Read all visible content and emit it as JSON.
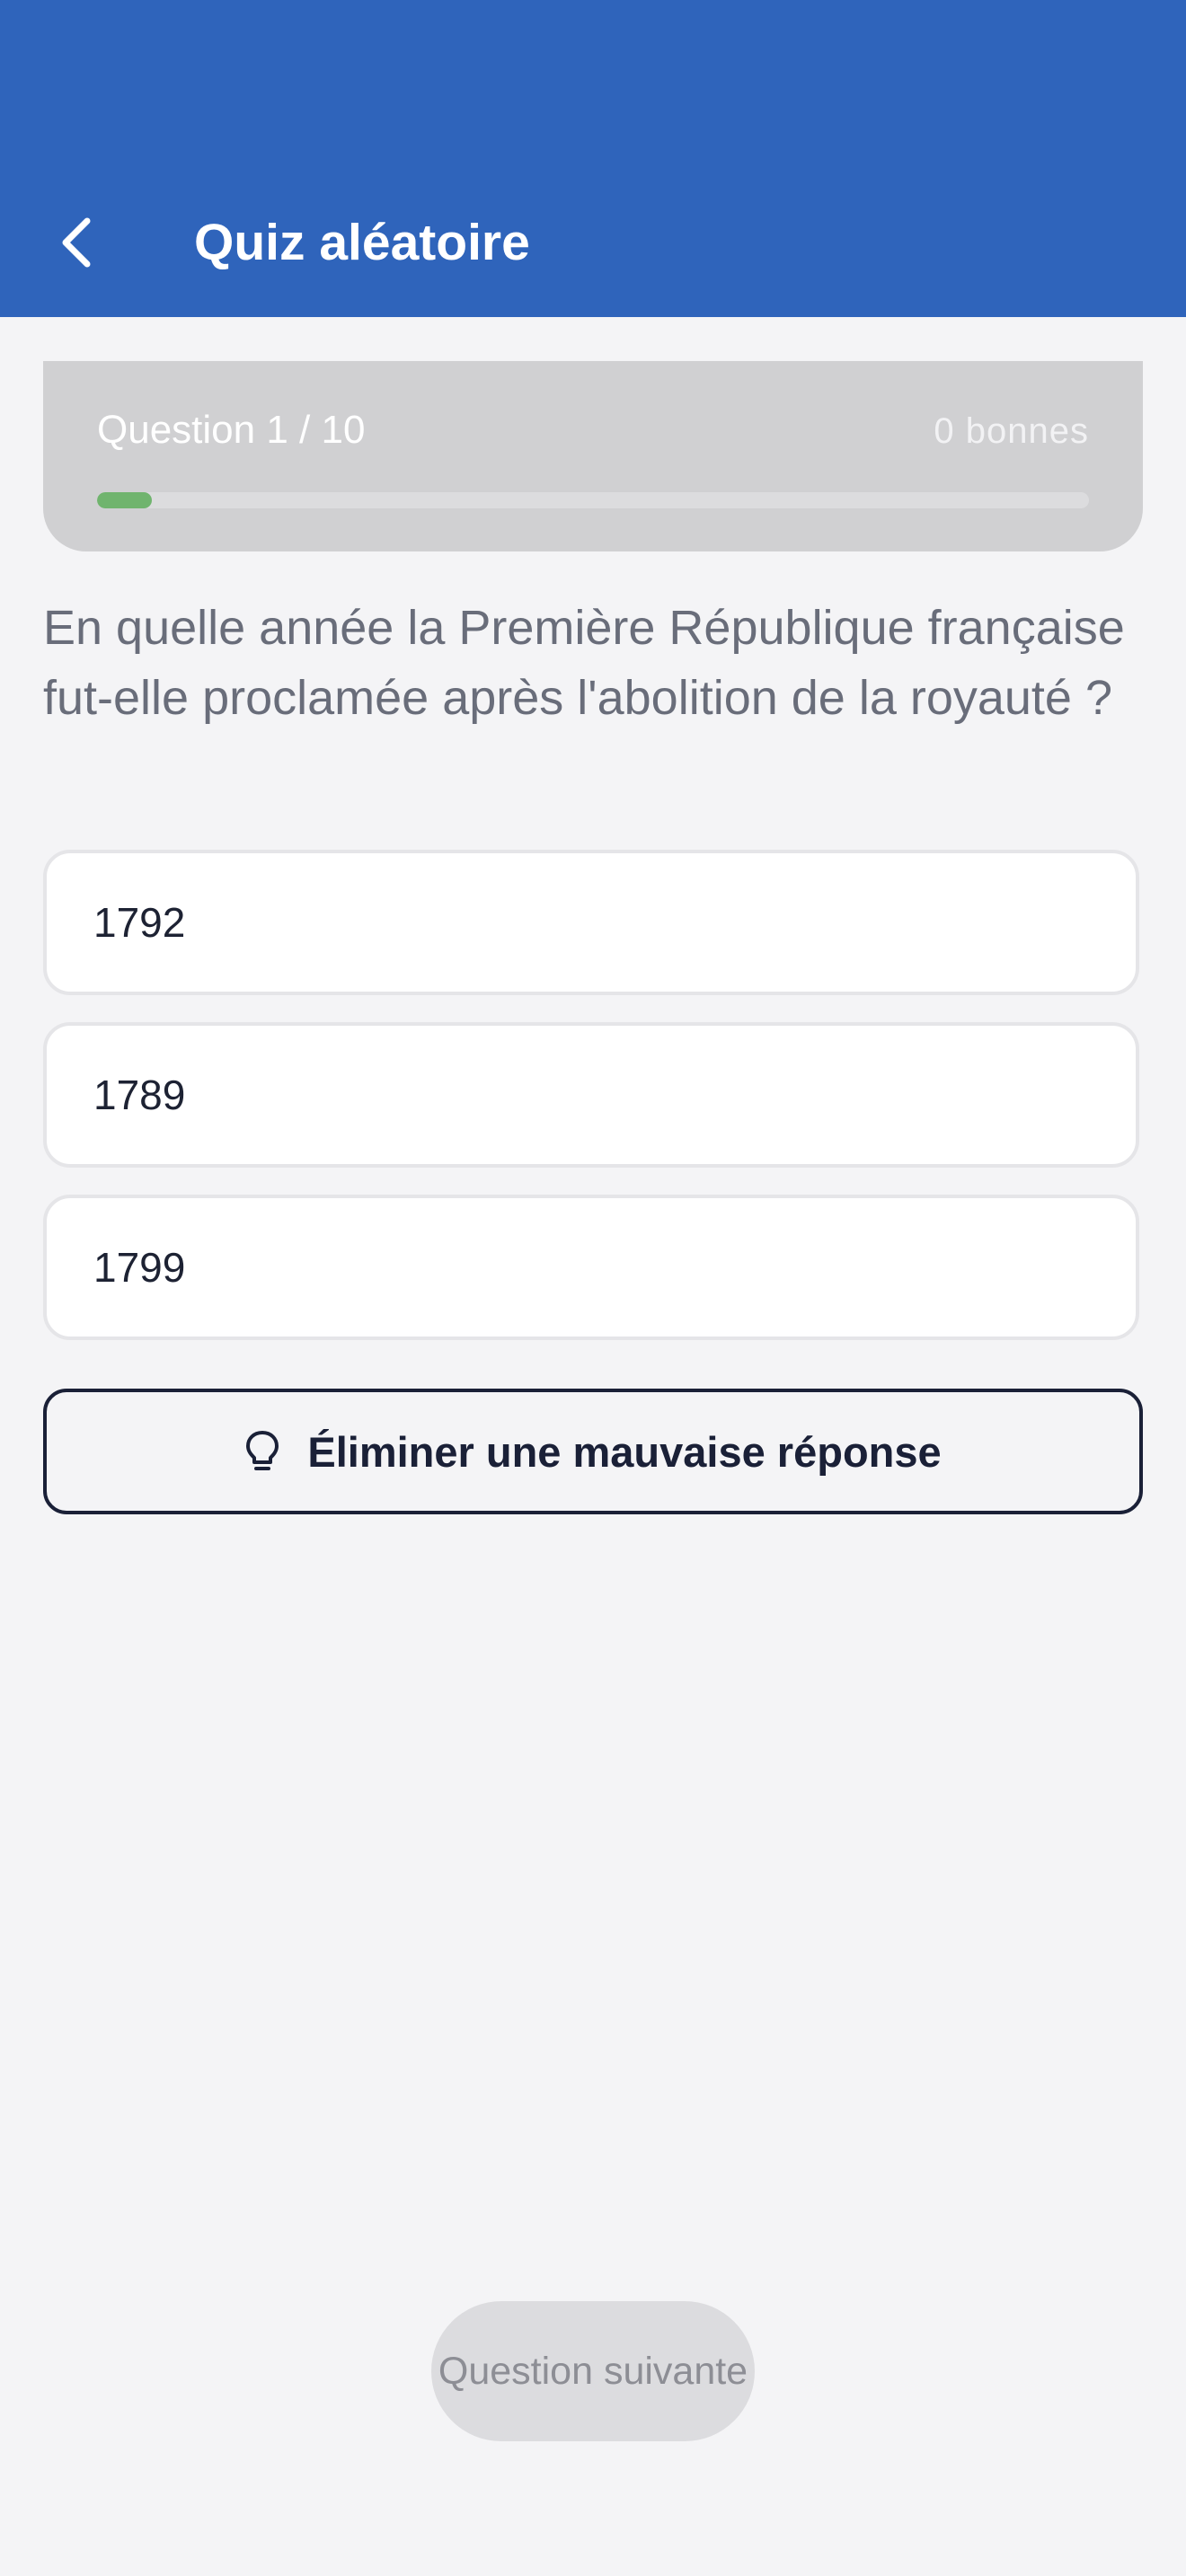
{
  "header": {
    "title": "Quiz aléatoire",
    "back_icon": "chevron-left-icon",
    "background": "#2f64bb"
  },
  "progress": {
    "counter": "Question 1 / 10",
    "score": "0 bonnes",
    "current": 1,
    "total": 10,
    "fraction": 0.055,
    "fill_color": "#70b46e"
  },
  "question": {
    "text": "En quelle année la Première République française fut-elle proclamée après l'abolition de la royauté ?"
  },
  "answers": [
    {
      "label": "1792"
    },
    {
      "label": "1789"
    },
    {
      "label": "1799"
    }
  ],
  "hint": {
    "label": "Éliminer une mauvaise réponse",
    "icon": "lightbulb-icon"
  },
  "footer": {
    "next_label": "Question suivante"
  }
}
